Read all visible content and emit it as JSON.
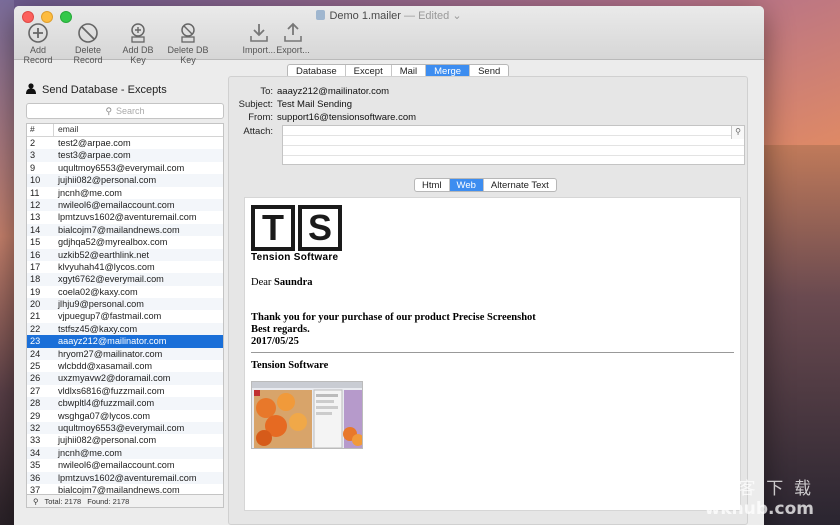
{
  "window": {
    "title": "Demo 1.mailer",
    "edited": "— Edited"
  },
  "toolbar": {
    "items": [
      {
        "label": "Add Record",
        "icon": "add-record-icon"
      },
      {
        "label": "Delete Record",
        "icon": "delete-record-icon"
      },
      {
        "label": "Add DB Key",
        "icon": "add-db-key-icon"
      },
      {
        "label": "Delete DB Key",
        "icon": "delete-db-key-icon"
      },
      {
        "label": "Import...",
        "icon": "import-icon"
      },
      {
        "label": "Export...",
        "icon": "export-icon"
      }
    ]
  },
  "tabs": [
    "Database",
    "Except",
    "Mail",
    "Merge",
    "Send"
  ],
  "active_tab": "Merge",
  "left_panel": {
    "title": "Send Database - Excepts",
    "search_placeholder": "Search",
    "columns": [
      "#",
      "email"
    ],
    "rows": [
      {
        "num": "2",
        "email": "test2@arpae.com"
      },
      {
        "num": "3",
        "email": "test3@arpae.com"
      },
      {
        "num": "9",
        "email": "uqultmoy6553@everymail.com"
      },
      {
        "num": "10",
        "email": "jujhii082@personal.com"
      },
      {
        "num": "11",
        "email": "jncnh@me.com"
      },
      {
        "num": "12",
        "email": "nwileol6@emailaccount.com"
      },
      {
        "num": "13",
        "email": "lpmtzuvs1602@aventuremail.com"
      },
      {
        "num": "14",
        "email": "bialcojm7@mailandnews.com"
      },
      {
        "num": "15",
        "email": "gdjhqa52@myrealbox.com"
      },
      {
        "num": "16",
        "email": "uzkib52@earthlink.net"
      },
      {
        "num": "17",
        "email": "klvyuhah41@lycos.com"
      },
      {
        "num": "18",
        "email": "xgyt6762@everymail.com"
      },
      {
        "num": "19",
        "email": "coela02@kaxy.com"
      },
      {
        "num": "20",
        "email": "jlhju9@personal.com"
      },
      {
        "num": "21",
        "email": "vjpuegup7@fastmail.com"
      },
      {
        "num": "22",
        "email": "tstfsz45@kaxy.com"
      },
      {
        "num": "23",
        "email": "aaayz212@mailinator.com"
      },
      {
        "num": "24",
        "email": "hryom27@mailinator.com"
      },
      {
        "num": "25",
        "email": "wlcbdd@xasamail.com"
      },
      {
        "num": "26",
        "email": "uxzmyavw2@doramail.com"
      },
      {
        "num": "27",
        "email": "vldlxs6816@fuzzmail.com"
      },
      {
        "num": "28",
        "email": "cbwpltl4@fuzzmail.com"
      },
      {
        "num": "29",
        "email": "wsghga07@lycos.com"
      },
      {
        "num": "32",
        "email": "uqultmoy6553@everymail.com"
      },
      {
        "num": "33",
        "email": "jujhii082@personal.com"
      },
      {
        "num": "34",
        "email": "jncnh@me.com"
      },
      {
        "num": "35",
        "email": "nwileol6@emailaccount.com"
      },
      {
        "num": "36",
        "email": "lpmtzuvs1602@aventuremail.com"
      },
      {
        "num": "37",
        "email": "bialcojm7@mailandnews.com"
      }
    ],
    "selected_num": "23",
    "footer_total": "Total: 2178",
    "footer_found": "Found: 2178"
  },
  "mail": {
    "to_label": "To:",
    "to": "aaayz212@mailinator.com",
    "subject_label": "Subject:",
    "subject": "Test Mail Sending",
    "from_label": "From:",
    "from": "support16@tensionsoftware.com",
    "attach_label": "Attach:"
  },
  "view_tabs": [
    "Html",
    "Web",
    "Alternate Text"
  ],
  "active_view": "Web",
  "preview": {
    "logo_letters": [
      "T",
      "S"
    ],
    "logo_text": "Tension Software",
    "dear_prefix": "Dear",
    "dear_name": "Saundra",
    "line1": "Thank you for your purchase of our product Precise Screenshot",
    "line2": "Best regards.",
    "line3": "2017/05/25",
    "signature": "Tension Software"
  },
  "watermark": {
    "cn": "风 客 下 载",
    "en": "wkhub.com"
  }
}
